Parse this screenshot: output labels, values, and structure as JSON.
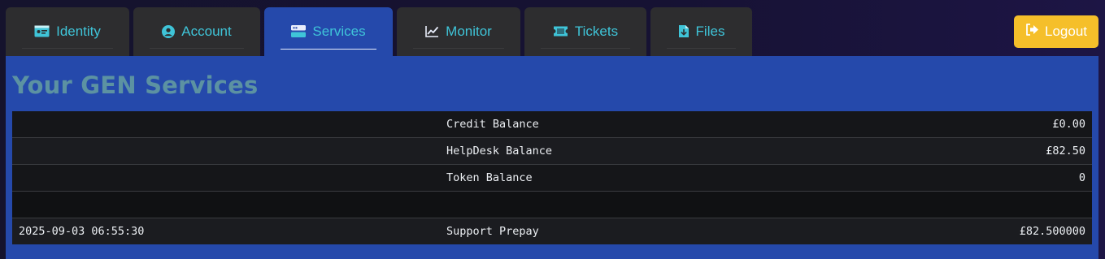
{
  "tabs": [
    {
      "label": "Identity",
      "icon": "id-card-icon"
    },
    {
      "label": "Account",
      "icon": "user-circle-icon"
    },
    {
      "label": "Services",
      "icon": "server-icon",
      "active": true
    },
    {
      "label": "Monitor",
      "icon": "chart-line-icon"
    },
    {
      "label": "Tickets",
      "icon": "ticket-icon"
    },
    {
      "label": "Files",
      "icon": "file-download-icon"
    }
  ],
  "logout": {
    "label": "Logout",
    "icon": "sign-out-icon"
  },
  "main": {
    "title": "Your GEN Services",
    "rows": [
      {
        "date": "",
        "label": "Credit Balance",
        "value": "£0.00"
      },
      {
        "date": "",
        "label": "HelpDesk Balance",
        "value": "£82.50"
      },
      {
        "date": "",
        "label": "Token Balance",
        "value": "0"
      },
      {
        "date": "",
        "label": "",
        "value": ""
      },
      {
        "date": "2025-09-03 06:55:30",
        "label": "Support Prepay",
        "value": "£82.500000"
      }
    ]
  },
  "colors": {
    "accent": "#3fc4d8",
    "panel": "#2549ab",
    "tab": "#2d2d2f",
    "logout": "#f5bf2a",
    "title": "#5c92a2"
  }
}
